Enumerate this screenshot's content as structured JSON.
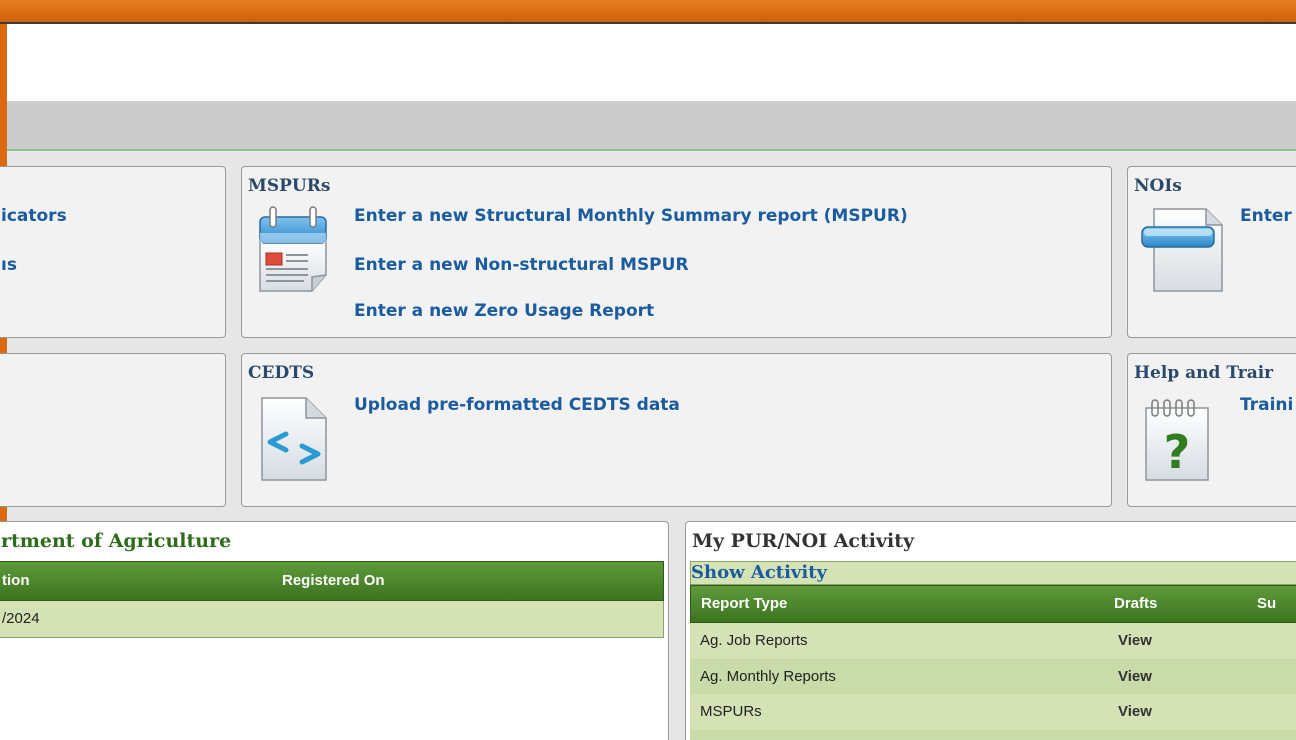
{
  "panels": {
    "left_top": {
      "links": [
        "icators",
        "ıs"
      ]
    },
    "mspurs": {
      "title": "MSPURs",
      "links": [
        "Enter a new Structural Monthly Summary report (MSPUR)",
        "Enter a new Non-structural MSPUR",
        "Enter a new Zero Usage Report"
      ]
    },
    "nois": {
      "title": "NOIs",
      "links": [
        "Enter"
      ]
    },
    "cedts": {
      "title": "CEDTS",
      "links": [
        "Upload pre-formatted CEDTS data"
      ]
    },
    "help": {
      "title": "Help and Trair",
      "links": [
        "Traini"
      ]
    }
  },
  "agriculture": {
    "title": "rtment of Agriculture",
    "columns": [
      "tion",
      "Registered On"
    ],
    "rows": [
      [
        "/2024",
        ""
      ]
    ]
  },
  "activity": {
    "title": "My PUR/NOI Activity",
    "show_activity": "Show Activity",
    "columns": [
      "Report Type",
      "Drafts",
      "Su"
    ],
    "rows": [
      {
        "type": "Ag. Job Reports",
        "drafts": "View"
      },
      {
        "type": "Ag. Monthly Reports",
        "drafts": "View"
      },
      {
        "type": "MSPURs",
        "drafts": "View"
      }
    ]
  },
  "colors": {
    "brand_orange": "#d96a12",
    "link_blue": "#1a5c9e",
    "grid_green": "#4a8a2c",
    "row_green": "#d4e2b6",
    "row_green_alt": "#c9dba8"
  },
  "icons": [
    "calendar-document-icon",
    "document-folder-icon",
    "code-file-icon",
    "help-notepad-icon"
  ]
}
